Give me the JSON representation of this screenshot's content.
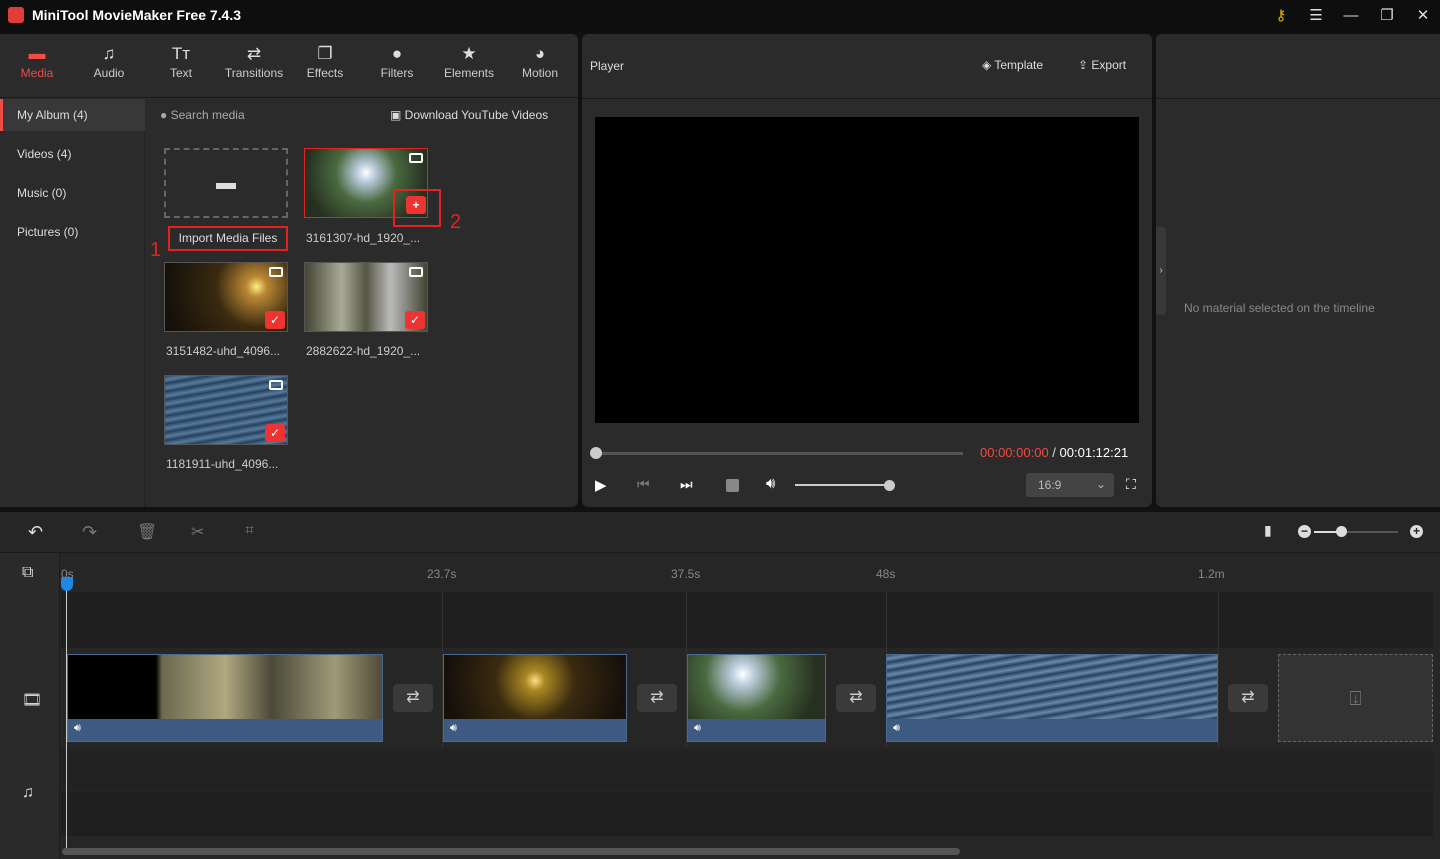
{
  "app": {
    "title": "MiniTool MovieMaker Free 7.4.3"
  },
  "toolbar": [
    {
      "label": "Media",
      "icon": "folder-icon",
      "glyph": "▬"
    },
    {
      "label": "Audio",
      "icon": "music-note-icon",
      "glyph": "♫"
    },
    {
      "label": "Text",
      "icon": "text-icon",
      "glyph": "Tт"
    },
    {
      "label": "Transitions",
      "icon": "transitions-icon",
      "glyph": "⇄"
    },
    {
      "label": "Effects",
      "icon": "effects-icon",
      "glyph": "❐"
    },
    {
      "label": "Filters",
      "icon": "filters-icon",
      "glyph": "●"
    },
    {
      "label": "Elements",
      "icon": "elements-icon",
      "glyph": "★"
    },
    {
      "label": "Motion",
      "icon": "motion-icon",
      "glyph": "◕"
    }
  ],
  "sidebar": [
    {
      "label": "My Album (4)"
    },
    {
      "label": "Videos (4)"
    },
    {
      "label": "Music (0)"
    },
    {
      "label": "Pictures (0)"
    }
  ],
  "media": {
    "search_placeholder": "Search media",
    "download_label": "Download YouTube Videos",
    "import_label": "Import Media Files",
    "items": [
      "3161307-hd_1920_...",
      "3151482-uhd_4096...",
      "2882622-hd_1920_...",
      "1181911-uhd_4096..."
    ],
    "annotations": [
      "1",
      "2"
    ]
  },
  "player": {
    "title": "Player",
    "template_label": "Template",
    "export_label": "Export",
    "current_time": "00:00:00:00",
    "separator": " / ",
    "total_time": "00:01:12:21",
    "aspect_ratio": "16:9",
    "progress": 0,
    "volume": 1.0
  },
  "properties": {
    "empty_message": "No material selected on the timeline"
  },
  "timeline": {
    "ticks": [
      "0s",
      "23.7s",
      "37.5s",
      "48s",
      "1.2m"
    ],
    "zoom_level": 0.3
  },
  "colors": {
    "accent": "#f04b44",
    "annotation": "#e52222",
    "clip": "#3d5a80"
  }
}
